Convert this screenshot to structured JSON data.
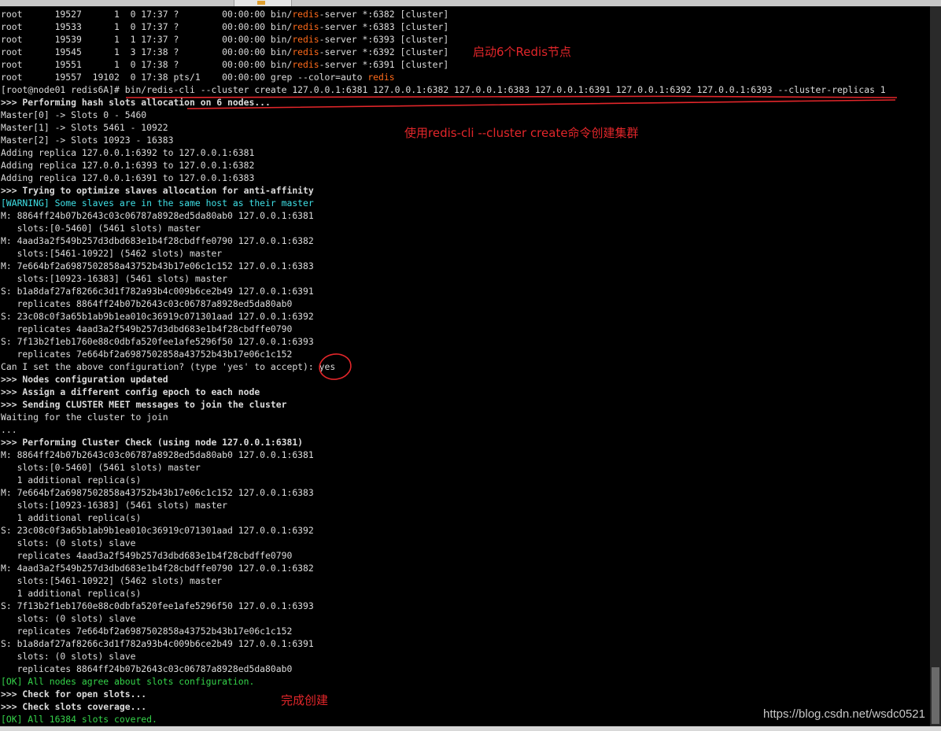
{
  "terminal": {
    "lines": [
      {
        "segments": [
          {
            "text": "root      19527      1  0 17:37 ?        00:00:00 bin/"
          },
          {
            "text": "redis",
            "style": "hl"
          },
          {
            "text": "-server *:6382 [cluster]"
          }
        ]
      },
      {
        "segments": [
          {
            "text": "root      19533      1  0 17:37 ?        00:00:00 bin/"
          },
          {
            "text": "redis",
            "style": "hl"
          },
          {
            "text": "-server *:6383 [cluster]"
          }
        ]
      },
      {
        "segments": [
          {
            "text": "root      19539      1  1 17:37 ?        00:00:00 bin/"
          },
          {
            "text": "redis",
            "style": "hl"
          },
          {
            "text": "-server *:6393 [cluster]"
          }
        ]
      },
      {
        "segments": [
          {
            "text": "root      19545      1  3 17:38 ?        00:00:00 bin/"
          },
          {
            "text": "redis",
            "style": "hl"
          },
          {
            "text": "-server *:6392 [cluster]"
          }
        ]
      },
      {
        "segments": [
          {
            "text": "root      19551      1  0 17:38 ?        00:00:00 bin/"
          },
          {
            "text": "redis",
            "style": "hl"
          },
          {
            "text": "-server *:6391 [cluster]"
          }
        ]
      },
      {
        "segments": [
          {
            "text": "root      19557  19102  0 17:38 pts/1    00:00:00 grep --color=auto "
          },
          {
            "text": "redis",
            "style": "hl"
          }
        ]
      },
      {
        "segments": [
          {
            "text": "[root@node01 redis6A]# bin/redis-cli --cluster create 127.0.0.1:6381 127.0.0.1:6382 127.0.0.1:6383 127.0.0.1:6391 127.0.0.1:6392 127.0.0.1:6393 --cluster-replicas 1"
          }
        ]
      },
      {
        "segments": [
          {
            "text": ">>> Performing hash slots allocation on 6 nodes...",
            "style": "bold"
          }
        ]
      },
      {
        "segments": [
          {
            "text": "Master[0] -> Slots 0 - 5460"
          }
        ]
      },
      {
        "segments": [
          {
            "text": "Master[1] -> Slots 5461 - 10922"
          }
        ]
      },
      {
        "segments": [
          {
            "text": "Master[2] -> Slots 10923 - 16383"
          }
        ]
      },
      {
        "segments": [
          {
            "text": "Adding replica 127.0.0.1:6392 to 127.0.0.1:6381"
          }
        ]
      },
      {
        "segments": [
          {
            "text": "Adding replica 127.0.0.1:6393 to 127.0.0.1:6382"
          }
        ]
      },
      {
        "segments": [
          {
            "text": "Adding replica 127.0.0.1:6391 to 127.0.0.1:6383"
          }
        ]
      },
      {
        "segments": [
          {
            "text": ">>> Trying to optimize slaves allocation for anti-affinity",
            "style": "bold"
          }
        ]
      },
      {
        "segments": [
          {
            "text": "[WARNING] Some slaves are in the same host as their master",
            "style": "warn"
          }
        ]
      },
      {
        "segments": [
          {
            "text": "M: 8864ff24b07b2643c03c06787a8928ed5da80ab0 127.0.0.1:6381"
          }
        ]
      },
      {
        "segments": [
          {
            "text": "   slots:[0-5460] (5461 slots) master"
          }
        ]
      },
      {
        "segments": [
          {
            "text": "M: 4aad3a2f549b257d3dbd683e1b4f28cbdffe0790 127.0.0.1:6382"
          }
        ]
      },
      {
        "segments": [
          {
            "text": "   slots:[5461-10922] (5462 slots) master"
          }
        ]
      },
      {
        "segments": [
          {
            "text": "M: 7e664bf2a6987502858a43752b43b17e06c1c152 127.0.0.1:6383"
          }
        ]
      },
      {
        "segments": [
          {
            "text": "   slots:[10923-16383] (5461 slots) master"
          }
        ]
      },
      {
        "segments": [
          {
            "text": "S: b1a8daf27af8266c3d1f782a93b4c009b6ce2b49 127.0.0.1:6391"
          }
        ]
      },
      {
        "segments": [
          {
            "text": "   replicates 8864ff24b07b2643c03c06787a8928ed5da80ab0"
          }
        ]
      },
      {
        "segments": [
          {
            "text": "S: 23c08c0f3a65b1ab9b1ea010c36919c071301aad 127.0.0.1:6392"
          }
        ]
      },
      {
        "segments": [
          {
            "text": "   replicates 4aad3a2f549b257d3dbd683e1b4f28cbdffe0790"
          }
        ]
      },
      {
        "segments": [
          {
            "text": "S: 7f13b2f1eb1760e88c0dbfa520fee1afe5296f50 127.0.0.1:6393"
          }
        ]
      },
      {
        "segments": [
          {
            "text": "   replicates 7e664bf2a6987502858a43752b43b17e06c1c152"
          }
        ]
      },
      {
        "segments": [
          {
            "text": "Can I set the above configuration? (type 'yes' to accept): yes"
          }
        ]
      },
      {
        "segments": [
          {
            "text": ">>> Nodes configuration updated",
            "style": "bold"
          }
        ]
      },
      {
        "segments": [
          {
            "text": ">>> Assign a different config epoch to each node",
            "style": "bold"
          }
        ]
      },
      {
        "segments": [
          {
            "text": ">>> Sending CLUSTER MEET messages to join the cluster",
            "style": "bold"
          }
        ]
      },
      {
        "segments": [
          {
            "text": "Waiting for the cluster to join"
          }
        ]
      },
      {
        "segments": [
          {
            "text": "..."
          }
        ]
      },
      {
        "segments": [
          {
            "text": ">>> Performing Cluster Check (using node 127.0.0.1:6381)",
            "style": "bold"
          }
        ]
      },
      {
        "segments": [
          {
            "text": "M: 8864ff24b07b2643c03c06787a8928ed5da80ab0 127.0.0.1:6381"
          }
        ]
      },
      {
        "segments": [
          {
            "text": "   slots:[0-5460] (5461 slots) master"
          }
        ]
      },
      {
        "segments": [
          {
            "text": "   1 additional replica(s)"
          }
        ]
      },
      {
        "segments": [
          {
            "text": "M: 7e664bf2a6987502858a43752b43b17e06c1c152 127.0.0.1:6383"
          }
        ]
      },
      {
        "segments": [
          {
            "text": "   slots:[10923-16383] (5461 slots) master"
          }
        ]
      },
      {
        "segments": [
          {
            "text": "   1 additional replica(s)"
          }
        ]
      },
      {
        "segments": [
          {
            "text": "S: 23c08c0f3a65b1ab9b1ea010c36919c071301aad 127.0.0.1:6392"
          }
        ]
      },
      {
        "segments": [
          {
            "text": "   slots: (0 slots) slave"
          }
        ]
      },
      {
        "segments": [
          {
            "text": "   replicates 4aad3a2f549b257d3dbd683e1b4f28cbdffe0790"
          }
        ]
      },
      {
        "segments": [
          {
            "text": "M: 4aad3a2f549b257d3dbd683e1b4f28cbdffe0790 127.0.0.1:6382"
          }
        ]
      },
      {
        "segments": [
          {
            "text": "   slots:[5461-10922] (5462 slots) master"
          }
        ]
      },
      {
        "segments": [
          {
            "text": "   1 additional replica(s)"
          }
        ]
      },
      {
        "segments": [
          {
            "text": "S: 7f13b2f1eb1760e88c0dbfa520fee1afe5296f50 127.0.0.1:6393"
          }
        ]
      },
      {
        "segments": [
          {
            "text": "   slots: (0 slots) slave"
          }
        ]
      },
      {
        "segments": [
          {
            "text": "   replicates 7e664bf2a6987502858a43752b43b17e06c1c152"
          }
        ]
      },
      {
        "segments": [
          {
            "text": "S: b1a8daf27af8266c3d1f782a93b4c009b6ce2b49 127.0.0.1:6391"
          }
        ]
      },
      {
        "segments": [
          {
            "text": "   slots: (0 slots) slave"
          }
        ]
      },
      {
        "segments": [
          {
            "text": "   replicates 8864ff24b07b2643c03c06787a8928ed5da80ab0"
          }
        ]
      },
      {
        "segments": [
          {
            "text": "[OK] All nodes agree about slots configuration.",
            "style": "ok"
          }
        ]
      },
      {
        "segments": [
          {
            "text": ">>> Check for open slots...",
            "style": "bold"
          }
        ]
      },
      {
        "segments": [
          {
            "text": ">>> Check slots coverage...",
            "style": "bold"
          }
        ]
      },
      {
        "segments": [
          {
            "text": "[OK] All 16384 slots covered.",
            "style": "ok"
          }
        ]
      }
    ]
  },
  "annotations": {
    "start_nodes": "启动6个Redis节点",
    "create_cluster": "使用redis-cli --cluster create命令创建集群",
    "done": "完成创建"
  },
  "watermark": "https://blog.csdn.net/wsdc0521",
  "colors": {
    "background": "#000000",
    "text": "#dcdcdc",
    "highlight": "#ff6a1a",
    "warning": "#3fe0e6",
    "ok": "#35d44a",
    "annotation": "#e2262a"
  }
}
